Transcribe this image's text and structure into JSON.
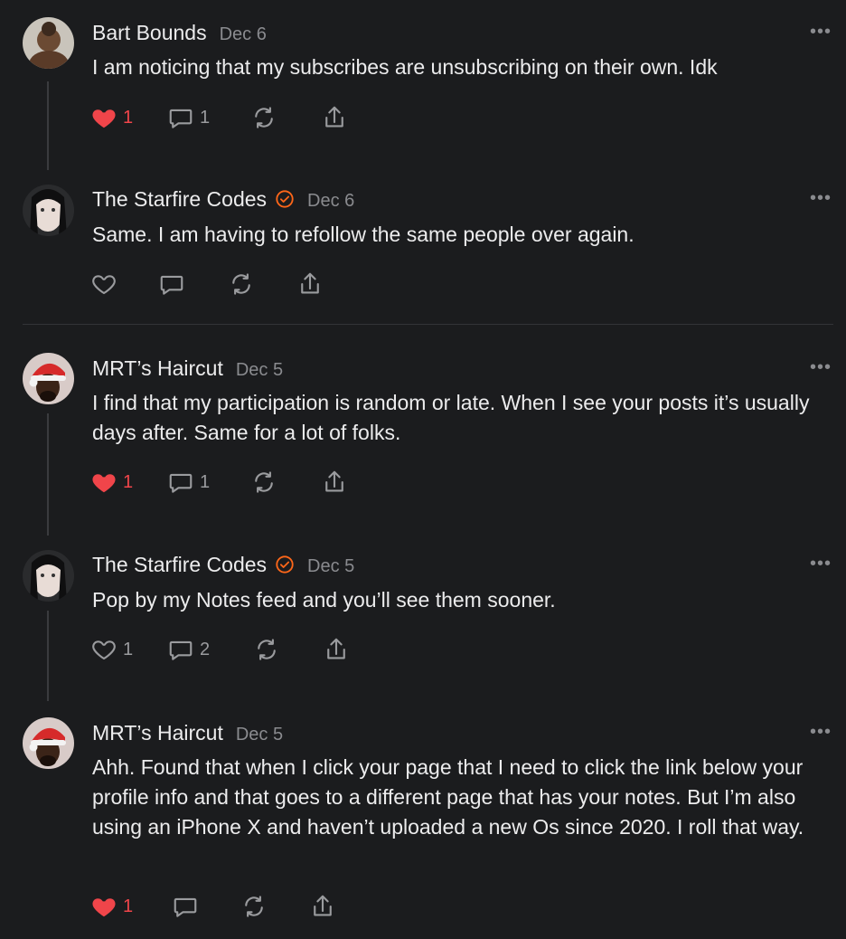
{
  "notes": [
    {
      "author": "Bart Bounds",
      "date": "Dec 6",
      "text": "I am noticing that my subscribes are unsubscribing on their own. Idk",
      "likes": "1",
      "comments": "1",
      "liked": true,
      "verified": false,
      "more_icon": "ellipsis-icon"
    },
    {
      "author": "The Starfire Codes",
      "date": "Dec 6",
      "text": "Same. I am having to refollow the same people over again.",
      "likes": "",
      "comments": "",
      "liked": false,
      "verified": true,
      "more_icon": "ellipsis-icon"
    },
    {
      "author": "MRT’s Haircut",
      "date": "Dec 5",
      "text": "I find that my participation is random or late. When I see your posts it’s usually days after. Same for a lot of folks.",
      "likes": "1",
      "comments": "1",
      "liked": true,
      "verified": false,
      "more_icon": "ellipsis-icon"
    },
    {
      "author": "The Starfire Codes",
      "date": "Dec 5",
      "text": "Pop by my Notes feed and you’ll see them sooner.",
      "likes": "1",
      "comments": "2",
      "liked": false,
      "verified": true,
      "more_icon": "ellipsis-icon"
    },
    {
      "author": "MRT’s Haircut",
      "date": "Dec 5",
      "text": "Ahh. Found that when I click your page that I need to click the link below your profile info and that goes to a different page that has your notes. But I’m also using an iPhone X and haven’t uploaded a new Os since 2020. I roll that way.",
      "likes": "1",
      "comments": "",
      "liked": true,
      "verified": false,
      "more_icon": "ellipsis-icon"
    }
  ],
  "colors": {
    "background": "#1b1c1e",
    "liked_heart": "#f0454a",
    "verified_badge": "#ff6719",
    "muted": "#8a8b8f"
  },
  "icons": [
    "heart-icon",
    "comment-icon",
    "restack-icon",
    "share-icon",
    "verified-badge-icon"
  ]
}
